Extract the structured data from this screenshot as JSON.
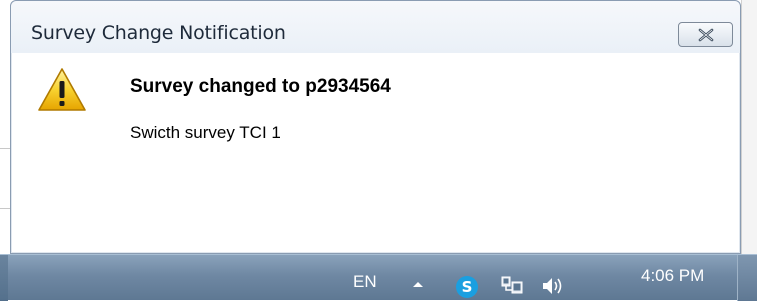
{
  "popup": {
    "title": "Survey Change Notification",
    "headline": "Survey changed to p2934564",
    "message": "Swicth survey TCI 1",
    "icon": "warning-icon",
    "close_icon": "close-icon"
  },
  "taskbar": {
    "language": "EN",
    "tray_icons": [
      "show-hidden-icons-arrow",
      "skype-icon",
      "network-icon",
      "volume-icon"
    ],
    "clock": "4:06 PM"
  },
  "colors": {
    "title_text": "#1e2a3a",
    "taskbar": "#6f88a3",
    "warning_yellow": "#f5c518"
  }
}
